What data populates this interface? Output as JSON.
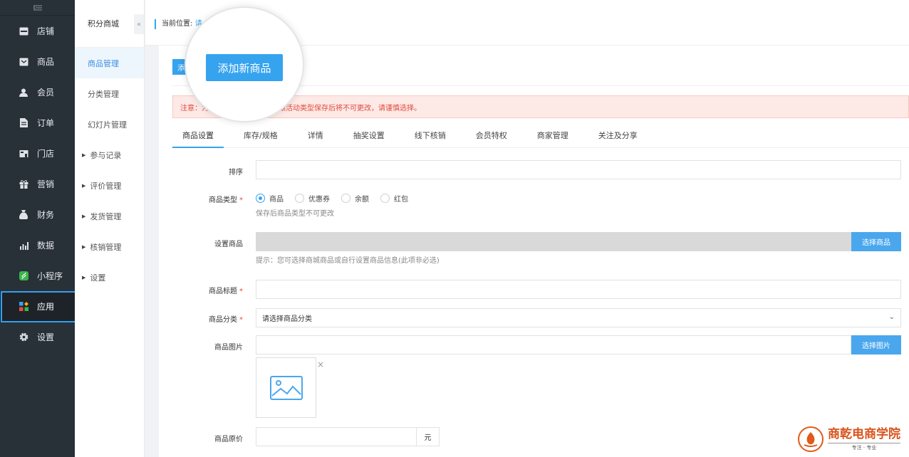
{
  "sidebar": {
    "collapse_icon": "menu-collapse-icon",
    "items": [
      {
        "label": "店铺",
        "icon": "store-icon"
      },
      {
        "label": "商品",
        "icon": "goods-icon"
      },
      {
        "label": "会员",
        "icon": "user-icon"
      },
      {
        "label": "订单",
        "icon": "order-icon"
      },
      {
        "label": "门店",
        "icon": "shop-icon"
      },
      {
        "label": "营销",
        "icon": "gift-icon"
      },
      {
        "label": "财务",
        "icon": "money-bag-icon"
      },
      {
        "label": "数据",
        "icon": "chart-icon"
      },
      {
        "label": "小程序",
        "icon": "miniprogram-icon"
      },
      {
        "label": "应用",
        "icon": "apps-icon",
        "active": true
      },
      {
        "label": "设置",
        "icon": "gear-icon"
      }
    ]
  },
  "submenu": {
    "title": "积分商城",
    "items": [
      {
        "label": "商品管理",
        "active": true
      },
      {
        "label": "分类管理"
      },
      {
        "label": "幻灯片管理"
      },
      {
        "label": "参与记录",
        "expandable": true
      },
      {
        "label": "评价管理",
        "expandable": true
      },
      {
        "label": "发货管理",
        "expandable": true
      },
      {
        "label": "核销管理",
        "expandable": true
      },
      {
        "label": "设置",
        "expandable": true
      }
    ]
  },
  "breadcrumb": {
    "prefix": "当前位置:",
    "link": "请"
  },
  "toolbar": {
    "add_label_partial": "添",
    "add_label_zoomed": "添加新商品"
  },
  "alert": {
    "text_start": "注意：为",
    "text_end": "品类型跟活动类型保存后将不可更改，请谨慎选择。"
  },
  "tabs": [
    "商品设置",
    "库存/规格",
    "详情",
    "抽奖设置",
    "线下核销",
    "会员特权",
    "商家管理",
    "关注及分享"
  ],
  "form": {
    "sort_label": "排序",
    "type_label": "商品类型",
    "type_options": [
      "商品",
      "优惠券",
      "余额",
      "红包"
    ],
    "type_selected": "商品",
    "type_hint": "保存后商品类型不可更改",
    "set_goods_label": "设置商品",
    "select_goods_button": "选择商品",
    "set_goods_hint": "提示：您可选择商城商品或自行设置商品信息(此项非必选)",
    "title_label": "商品标题",
    "category_label": "商品分类",
    "category_value": "请选择商品分类",
    "image_label": "商品图片",
    "select_image_button": "选择图片",
    "image_placeholder_icon": "image-placeholder-icon",
    "close_icon": "close-icon",
    "price_label": "商品原价",
    "price_unit": "元",
    "required_mark": "*"
  },
  "watermark": {
    "title": "商乾电商学院",
    "subtitle": "专注 · 专业"
  },
  "colors": {
    "sidebar_bg": "#283038",
    "accent": "#36a3ef",
    "alert_bg": "#fde9e6",
    "alert_text": "#e04b3a",
    "watermark": "#d9541c"
  }
}
